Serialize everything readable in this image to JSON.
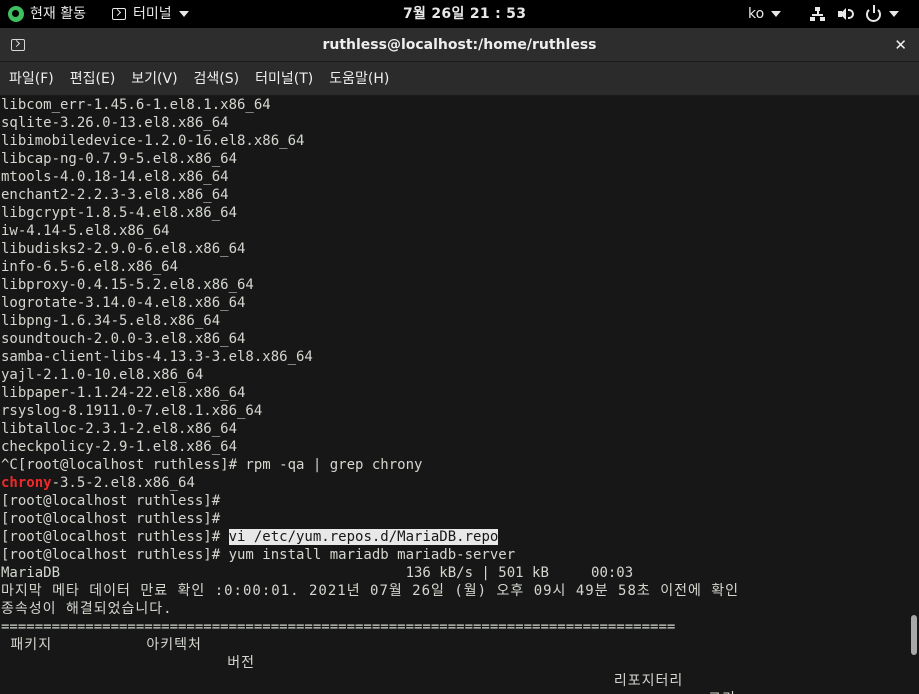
{
  "topbar": {
    "activities": "현재 활동",
    "app_name": "터미널",
    "clock": "7월 26일  21 : 53",
    "language": "ko"
  },
  "window": {
    "title": "ruthless@localhost:/home/ruthless",
    "close_glyph": "✕"
  },
  "menu": [
    "파일(F)",
    "편집(E)",
    "보기(V)",
    "검색(S)",
    "터미널(T)",
    "도움말(H)"
  ],
  "terminal": {
    "packages": [
      "libcom_err-1.45.6-1.el8.1.x86_64",
      "sqlite-3.26.0-13.el8.x86_64",
      "libimobiledevice-1.2.0-16.el8.x86_64",
      "libcap-ng-0.7.9-5.el8.x86_64",
      "mtools-4.0.18-14.el8.x86_64",
      "enchant2-2.2.3-3.el8.x86_64",
      "libgcrypt-1.8.5-4.el8.x86_64",
      "iw-4.14-5.el8.x86_64",
      "libudisks2-2.9.0-6.el8.x86_64",
      "info-6.5-6.el8.x86_64",
      "libproxy-0.4.15-5.2.el8.x86_64",
      "logrotate-3.14.0-4.el8.x86_64",
      "libpng-1.6.34-5.el8.x86_64",
      "soundtouch-2.0.0-3.el8.x86_64",
      "samba-client-libs-4.13.3-3.el8.x86_64",
      "yajl-2.1.0-10.el8.x86_64",
      "libpaper-1.1.24-22.el8.x86_64",
      "rsyslog-8.1911.0-7.el8.1.x86_64",
      "libtalloc-2.3.1-2.el8.x86_64",
      "checkpolicy-2.9-1.el8.x86_64"
    ],
    "cmd_grep": "^C[root@localhost ruthless]# rpm -qa | grep chrony",
    "grep_match": "chrony",
    "grep_rest": "-3.5-2.el8.x86_64",
    "prompt_empty_1": "[root@localhost ruthless]#",
    "prompt_empty_2": "[root@localhost ruthless]#",
    "prompt_vi": "[root@localhost ruthless]# ",
    "cmd_vi": "vi /etc/yum.repos.d/MariaDB.repo",
    "cmd_yum": "[root@localhost ruthless]# yum install mariadb mariadb-server",
    "repo_line": "MariaDB                                         136 kB/s | 501 kB     00:03",
    "metadata_line": "마지막 메타 데이터 만료 확인 :0:00:01. 2021년 07월 26일 (월) 오후 09시 49분 58초 이전에 확인",
    "deps_line": "종속성이 해결되었습니다.",
    "separator": "================================================================================",
    "col_header_1": " 패키지          아키텍처",
    "col_header_2": "                        버전",
    "col_header_3": "                                                                 리포지터리",
    "col_header_4": "                                                                           크기"
  }
}
